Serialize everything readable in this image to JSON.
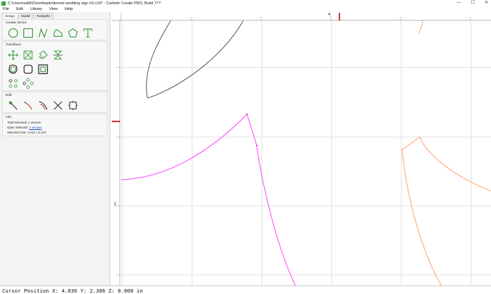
{
  "window": {
    "title": "C:\\Users\\willk\\Downloads\\lieneel wedding sign #3.c2d* - Carbide Create PRO, Build 777",
    "controls": [
      "—",
      "☐",
      "✕"
    ]
  },
  "menu": [
    "File",
    "Edit",
    "Library",
    "View",
    "Help"
  ],
  "tabs": [
    "Design",
    "Model",
    "Toolpaths"
  ],
  "sections": {
    "create_vector": "Create Vector",
    "transform": "Transform",
    "edit": "Edit",
    "info": "Info"
  },
  "info": {
    "total_selected_label": "Total Selected:",
    "total_selected_value": "1 Vectors",
    "open_selected_label": "Open Selected:",
    "open_selected_value": "1 Vectors",
    "selected_size_label": "Selected Size:",
    "selected_size_value": "4.412 x 3.472"
  },
  "rulers": {
    "h_label": "4",
    "v_label": "2"
  },
  "colors": {
    "tool_icon": "#3a9a3a",
    "selection": "#ff33ff",
    "toolpath": "#ff6a1a",
    "vector": "#333333",
    "grid": "#d8d8d8",
    "marker": "#e03030"
  },
  "status": {
    "cursor": "Cursor Position X: 4.036 Y: 2.306 Z: 0.000 in"
  }
}
